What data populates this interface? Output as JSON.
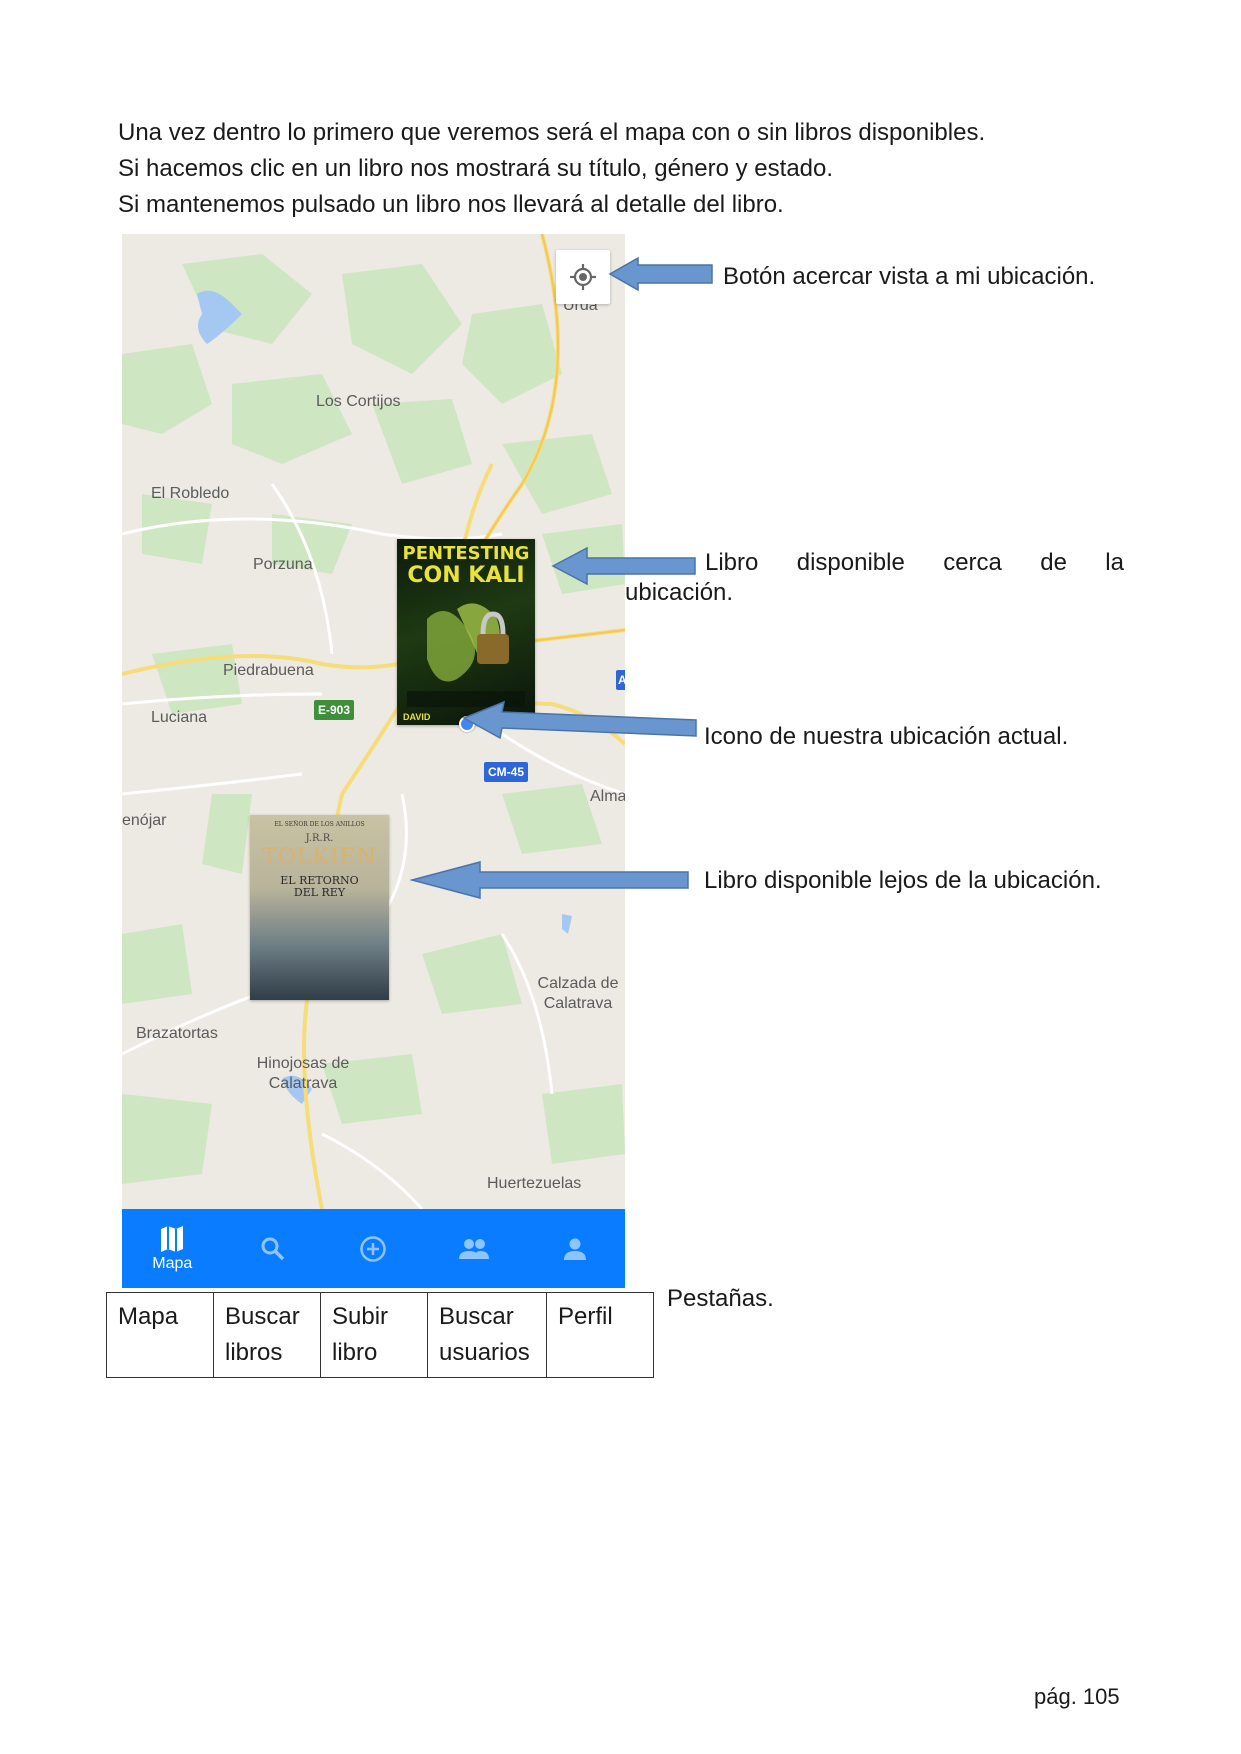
{
  "intro": {
    "line1": "Una vez dentro lo primero que veremos será el mapa con o sin libros disponibles.",
    "line2": "Si hacemos clic en un libro nos mostrará su título, género y estado.",
    "line3": "Si mantenemos pulsado un libro nos llevará al detalle del libro."
  },
  "map": {
    "places": {
      "urda": "Urda",
      "los_cortijos": "Los Cortijos",
      "el_robledo": "El Robledo",
      "porzuna": "Porzuna",
      "piedrabuena": "Piedrabuena",
      "luciana": "Luciana",
      "enojar": "enójar",
      "almagro": "Alma",
      "calzada": "Calzada de Calatrava",
      "brazatortas": "Brazatortas",
      "hinojosas": "Hinojosas de Calatrava",
      "huertezuelas": "Huertezuelas"
    },
    "road_labels": {
      "e903": "E-903",
      "cm45": "CM-45",
      "a_partial": "A"
    },
    "book_near": {
      "title_1": "PENTESTING",
      "title_2": "CON KALI",
      "author": "DAVID"
    },
    "book_far": {
      "series": "EL SEÑOR DE LOS ANILLOS",
      "author_initials": "J.R.R.",
      "author": "TOLKIEN",
      "title": "EL RETORNO DEL REY"
    }
  },
  "navbar": {
    "items": [
      {
        "icon": "map-icon",
        "label": "Mapa"
      },
      {
        "icon": "search-icon",
        "label": ""
      },
      {
        "icon": "add-circle-icon",
        "label": ""
      },
      {
        "icon": "people-icon",
        "label": ""
      },
      {
        "icon": "person-icon",
        "label": ""
      }
    ],
    "color": "#0a7cff"
  },
  "annotations": {
    "location_button": "Botón acercar vista a mi ubicación.",
    "book_near_words": [
      "Libro",
      "disponible",
      "cerca",
      "de",
      "la"
    ],
    "book_near_line2": "ubicación.",
    "current_location": "Icono de nuestra ubicación actual.",
    "book_far": "Libro disponible lejos de la ubicación.",
    "tabs": "Pestañas.",
    "arrow_color": "#6a96cf"
  },
  "tabs_table": [
    [
      "Mapa",
      ""
    ],
    [
      "Buscar",
      "libros"
    ],
    [
      "Subir",
      "libro"
    ],
    [
      "Buscar",
      "usuarios"
    ],
    [
      "Perfil",
      ""
    ]
  ],
  "page": {
    "number": "pág. 105"
  }
}
